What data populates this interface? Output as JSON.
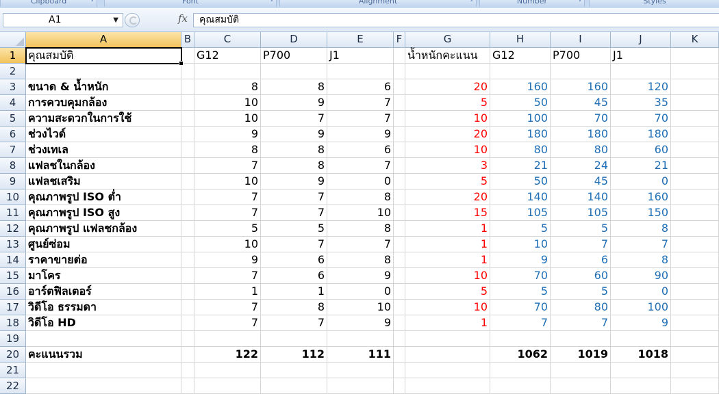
{
  "ribbon": {
    "groups": [
      {
        "name": "clipboard",
        "label": "Clipboard"
      },
      {
        "name": "font",
        "label": "Font"
      },
      {
        "name": "alignment",
        "label": "Alignment"
      },
      {
        "name": "number",
        "label": "Number"
      },
      {
        "name": "styles",
        "label": "Styles"
      }
    ]
  },
  "formula_bar": {
    "name_box": "A1",
    "fx_label": "fx",
    "formula": "คุณสมบัติ"
  },
  "columns": [
    "A",
    "B",
    "C",
    "D",
    "E",
    "F",
    "G",
    "H",
    "I",
    "J",
    "K"
  ],
  "selected_cell": "A1",
  "rows": [
    {
      "n": "1",
      "a": "คุณสมบัติ",
      "c": "G12",
      "d": "P700",
      "e": "J1",
      "g": "น้ำหนักคะแนน",
      "h": "G12",
      "i": "P700",
      "j": "J1"
    },
    {
      "n": "2"
    },
    {
      "n": "3",
      "a": "ขนาด & น้ำหนัก",
      "c": "8",
      "d": "8",
      "e": "6",
      "g": "20",
      "h": "160",
      "i": "160",
      "j": "120"
    },
    {
      "n": "4",
      "a": "การควบคุมกล้อง",
      "c": "10",
      "d": "9",
      "e": "7",
      "g": "5",
      "h": "50",
      "i": "45",
      "j": "35"
    },
    {
      "n": "5",
      "a": "ความสะดวกในการใช้",
      "c": "10",
      "d": "7",
      "e": "7",
      "g": "10",
      "h": "100",
      "i": "70",
      "j": "70"
    },
    {
      "n": "6",
      "a": "ช่วงไวด์",
      "c": "9",
      "d": "9",
      "e": "9",
      "g": "20",
      "h": "180",
      "i": "180",
      "j": "180"
    },
    {
      "n": "7",
      "a": "ช่วงเทเล",
      "c": "8",
      "d": "8",
      "e": "6",
      "g": "10",
      "h": "80",
      "i": "80",
      "j": "60"
    },
    {
      "n": "8",
      "a": "แฟลชในกล้อง",
      "c": "7",
      "d": "8",
      "e": "7",
      "g": "3",
      "h": "21",
      "i": "24",
      "j": "21"
    },
    {
      "n": "9",
      "a": "แฟลชเสริม",
      "c": "10",
      "d": "9",
      "e": "0",
      "g": "5",
      "h": "50",
      "i": "45",
      "j": "0"
    },
    {
      "n": "10",
      "a": "คุณภาพรูป ISO ต่ำ",
      "c": "7",
      "d": "7",
      "e": "8",
      "g": "20",
      "h": "140",
      "i": "140",
      "j": "160"
    },
    {
      "n": "11",
      "a": "คุณภาพรูป ISO สูง",
      "c": "7",
      "d": "7",
      "e": "10",
      "g": "15",
      "h": "105",
      "i": "105",
      "j": "150"
    },
    {
      "n": "12",
      "a": "คุณภาพรูป แฟลชกล้อง",
      "c": "5",
      "d": "5",
      "e": "8",
      "g": "1",
      "h": "5",
      "i": "5",
      "j": "8"
    },
    {
      "n": "13",
      "a": "ศูนย์ซ่อม",
      "c": "10",
      "d": "7",
      "e": "7",
      "g": "1",
      "h": "10",
      "i": "7",
      "j": "7"
    },
    {
      "n": "14",
      "a": "ราคาขายต่อ",
      "c": "9",
      "d": "6",
      "e": "8",
      "g": "1",
      "h": "9",
      "i": "6",
      "j": "8"
    },
    {
      "n": "15",
      "a": "มาโคร",
      "c": "7",
      "d": "6",
      "e": "9",
      "g": "10",
      "h": "70",
      "i": "60",
      "j": "90"
    },
    {
      "n": "16",
      "a": "อาร์ตฟิลเตอร์",
      "c": "1",
      "d": "1",
      "e": "0",
      "g": "5",
      "h": "5",
      "i": "5",
      "j": "0"
    },
    {
      "n": "17",
      "a": "วิดีโอ ธรรมดา",
      "c": "7",
      "d": "8",
      "e": "10",
      "g": "10",
      "h": "70",
      "i": "80",
      "j": "100"
    },
    {
      "n": "18",
      "a": "วิดีโอ HD",
      "c": "7",
      "d": "7",
      "e": "9",
      "g": "1",
      "h": "7",
      "i": "7",
      "j": "9"
    },
    {
      "n": "19"
    },
    {
      "n": "20",
      "a": "คะแนนรวม",
      "c": "122",
      "d": "112",
      "e": "111",
      "h": "1062",
      "i": "1019",
      "j": "1018"
    },
    {
      "n": "21"
    },
    {
      "n": "22"
    }
  ],
  "colors": {
    "weight_text": "#ff0000",
    "weighted_score_text": "#1f6fb6",
    "selected_header": "#f3c35c",
    "header_bg": "#dde7f3"
  }
}
